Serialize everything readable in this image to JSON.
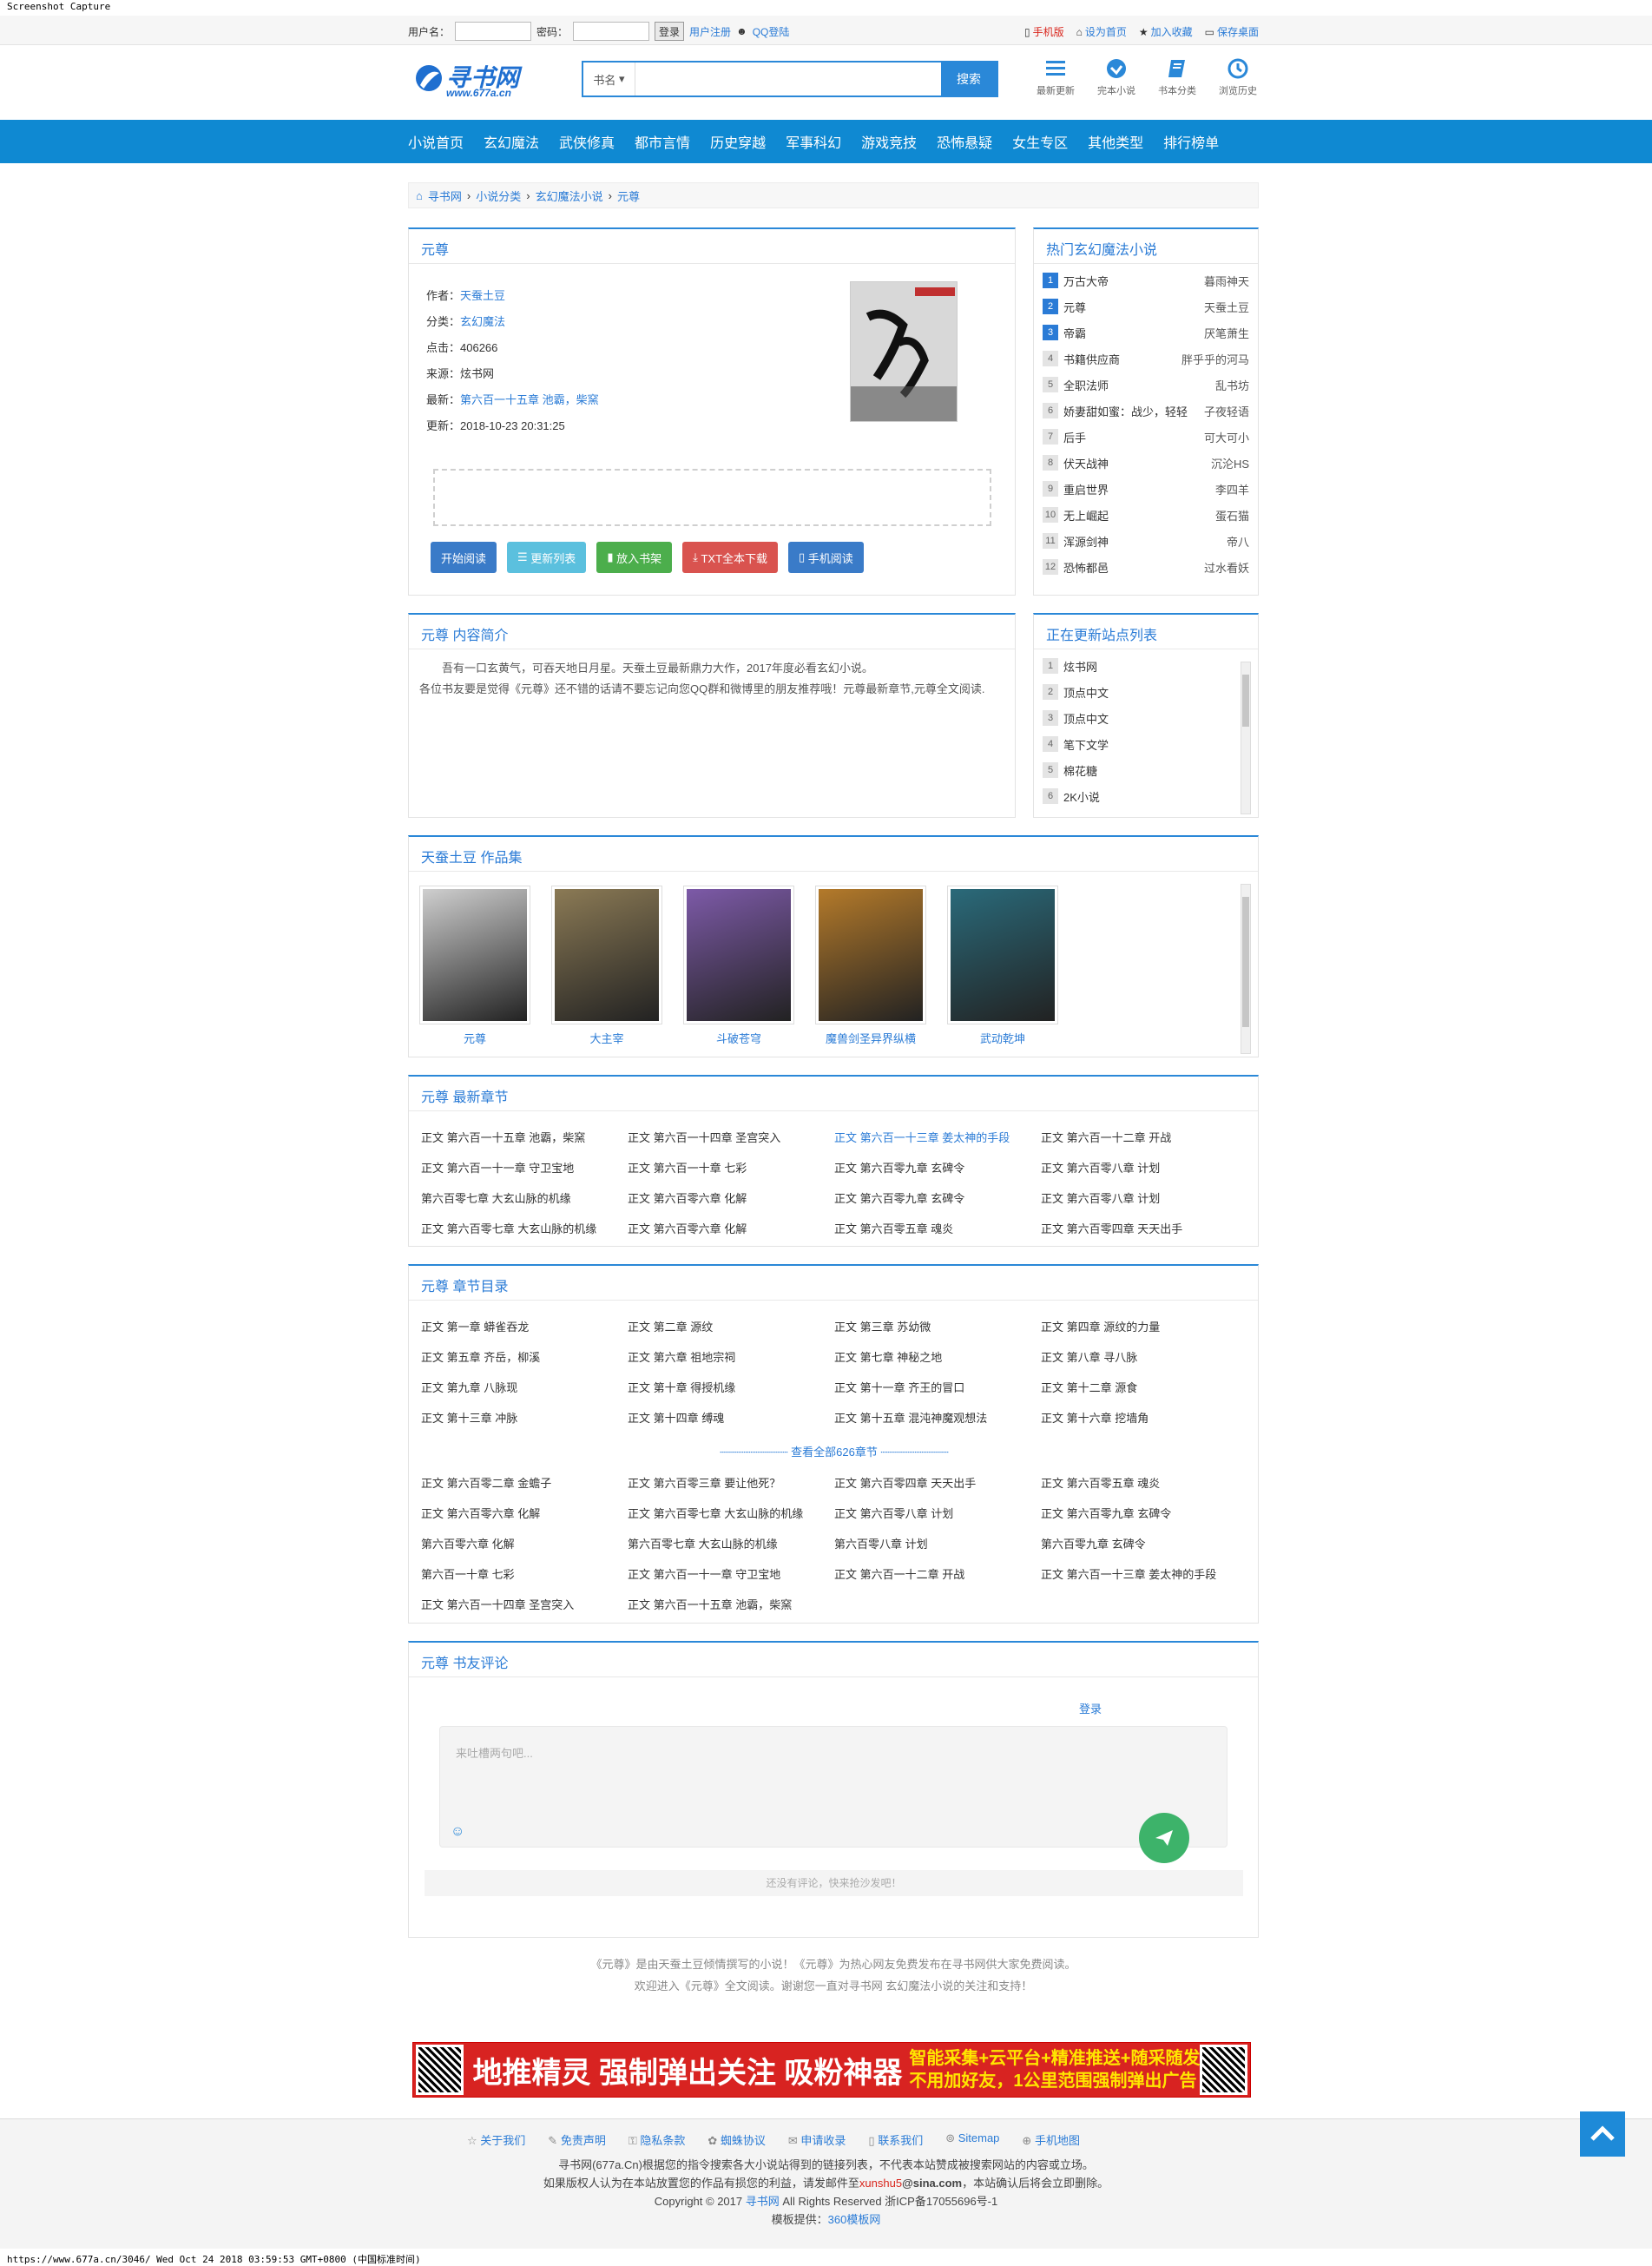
{
  "capture_title": "Screenshot Capture",
  "topbar": {
    "username_label": "用户名：",
    "password_label": "密码：",
    "login_btn": "登录",
    "register": "用户注册",
    "qq_login": "QQ登陆",
    "mobile": "手机版",
    "set_home": "设为首页",
    "favorite": "加入收藏",
    "save_desktop": "保存桌面"
  },
  "header": {
    "logo_text": "寻书网",
    "logo_url": "www.677a.cn",
    "search_select": "书名",
    "search_btn": "搜索",
    "quick": [
      "最新更新",
      "完本小说",
      "书本分类",
      "浏览历史"
    ]
  },
  "nav": [
    "小说首页",
    "玄幻魔法",
    "武侠修真",
    "都市言情",
    "历史穿越",
    "军事科幻",
    "游戏竞技",
    "恐怖悬疑",
    "女生专区",
    "其他类型",
    "排行榜单"
  ],
  "breadcrumb": [
    "寻书网",
    "小说分类",
    "玄幻魔法小说",
    "元尊"
  ],
  "book": {
    "title": "元尊",
    "author_label": "作者：",
    "author": "天蚕土豆",
    "category_label": "分类：",
    "category": "玄幻魔法",
    "clicks_label": "点击：",
    "clicks": "406266",
    "source_label": "来源：",
    "source": "炫书网",
    "latest_label": "最新：",
    "latest": "第六百一十五章 池霸，柴窯",
    "updated_label": "更新：",
    "updated": "2018-10-23 20:31:25",
    "buttons": [
      "开始阅读",
      "更新列表",
      "放入书架",
      "TXT全本下载",
      "手机阅读"
    ]
  },
  "hot": {
    "title": "热门玄幻魔法小说",
    "items": [
      {
        "n": "1",
        "name": "万古大帝",
        "author": "暮雨神天"
      },
      {
        "n": "2",
        "name": "元尊",
        "author": "天蚕土豆"
      },
      {
        "n": "3",
        "name": "帝霸",
        "author": "厌笔萧生"
      },
      {
        "n": "4",
        "name": "书籍供应商",
        "author": "胖乎乎的河马"
      },
      {
        "n": "5",
        "name": "全职法师",
        "author": "乱书坊"
      },
      {
        "n": "6",
        "name": "娇妻甜如蜜：战少，轻轻",
        "author": "子夜轻语"
      },
      {
        "n": "7",
        "name": "后手",
        "author": "可大可小"
      },
      {
        "n": "8",
        "name": "伏天战神",
        "author": "沉沦HS"
      },
      {
        "n": "9",
        "name": "重启世界",
        "author": "李四羊"
      },
      {
        "n": "10",
        "name": "无上崛起",
        "author": "蛋石猫"
      },
      {
        "n": "11",
        "name": "浑源剑神",
        "author": "帝八"
      },
      {
        "n": "12",
        "name": "恐怖都邑",
        "author": "过水看妖"
      }
    ]
  },
  "intro": {
    "title": "元尊 内容简介",
    "text1": "吾有一口玄黄气，可吞天地日月星。天蚕土豆最新鼎力大作，2017年度必看玄幻小说。",
    "text2": "各位书友要是觉得《元尊》还不错的话请不要忘记向您QQ群和微博里的朋友推荐哦！元尊最新章节,元尊全文阅读."
  },
  "sites": {
    "title": "正在更新站点列表",
    "items": [
      {
        "n": "1",
        "name": "炫书网"
      },
      {
        "n": "2",
        "name": "顶点中文"
      },
      {
        "n": "3",
        "name": "顶点中文"
      },
      {
        "n": "4",
        "name": "笔下文学"
      },
      {
        "n": "5",
        "name": "棉花糖"
      },
      {
        "n": "6",
        "name": "2K小说"
      }
    ]
  },
  "works": {
    "title": "天蚕土豆 作品集",
    "books": [
      {
        "name": "元尊",
        "color": "#cfcfcf"
      },
      {
        "name": "大主宰",
        "color": "#8b7a55"
      },
      {
        "name": "斗破苍穹",
        "color": "#7d5aa8"
      },
      {
        "name": "魔兽剑圣异界纵横",
        "color": "#b47a2a"
      },
      {
        "name": "武动乾坤",
        "color": "#2a6a7a"
      }
    ]
  },
  "latest": {
    "title": "元尊 最新章节",
    "chapters": [
      "正文 第六百一十五章 池霸，柴窯",
      "正文 第六百一十四章 圣宫突入",
      "正文 第六百一十三章 姜太神的手段",
      "正文 第六百一十二章 开战",
      "正文 第六百一十一章 守卫宝地",
      "正文 第六百一十章 七彩",
      "正文 第六百零九章 玄碑令",
      "正文 第六百零八章 计划",
      "第六百零七章 大玄山脉的机缘",
      "正文 第六百零六章 化解",
      "正文 第六百零九章 玄碑令",
      "正文 第六百零八章 计划",
      "正文 第六百零七章 大玄山脉的机缘",
      "正文 第六百零六章 化解",
      "正文 第六百零五章 魂炎",
      "正文 第六百零四章 天天出手"
    ]
  },
  "toc": {
    "title": "元尊 章节目录",
    "first": [
      "正文 第一章 蟒雀吞龙",
      "正文 第二章 源纹",
      "正文 第三章 苏幼微",
      "正文 第四章 源纹的力量",
      "正文 第五章 齐岳，柳溪",
      "正文 第六章 祖地宗祠",
      "正文 第七章 神秘之地",
      "正文 第八章 寻八脉",
      "正文 第九章 八脉现",
      "正文 第十章 得授机缘",
      "正文 第十一章 齐王的冒口",
      "正文 第十二章 源食",
      "正文 第十三章 冲脉",
      "正文 第十四章 缚魂",
      "正文 第十五章 混沌神魔观想法",
      "正文 第十六章 挖墙角"
    ],
    "more": "查看全部626章节",
    "last": [
      "正文 第六百零二章 金蟾子",
      "正文 第六百零三章 要让他死？",
      "正文 第六百零四章 天天出手",
      "正文 第六百零五章 魂炎",
      "正文 第六百零六章 化解",
      "正文 第六百零七章 大玄山脉的机缘",
      "正文 第六百零八章 计划",
      "正文 第六百零九章 玄碑令",
      "第六百零六章 化解",
      "第六百零七章 大玄山脉的机缘",
      "第六百零八章 计划",
      "第六百零九章 玄碑令",
      "第六百一十章 七彩",
      "正文 第六百一十一章 守卫宝地",
      "正文 第六百一十二章 开战",
      "正文 第六百一十三章 姜太神的手段",
      "正文 第六百一十四章 圣宫突入",
      "正文 第六百一十五章 池霸，柴窯"
    ]
  },
  "comments": {
    "title": "元尊 书友评论",
    "login": "登录",
    "placeholder": "来吐槽两句吧...",
    "empty": "还没有评论，快来抢沙发吧！"
  },
  "desc": {
    "line1": "《元尊》是由天蚕土豆倾情撰写的小说！《元尊》为热心网友免费发布在寻书网供大家免费阅读。",
    "line2": "欢迎进入《元尊》全文阅读。谢谢您一直对寻书网 玄幻魔法小说的关注和支持！"
  },
  "ad": {
    "main": "地推精灵 强制弹出关注 吸粉神器",
    "line1": "智能采集+云平台+精准推送+随采随发",
    "line2": "不用加好友，1公里范围强制弹出广告"
  },
  "footer": {
    "links": [
      "关于我们",
      "免责声明",
      "隐私条款",
      "蜘蛛协议",
      "申请收录",
      "联系我们",
      "Sitemap",
      "手机地图"
    ],
    "line1": "寻书网(677a.Cn)根据您的指令搜索各大小说站得到的链接列表，不代表本站赞成被搜索网站的内容或立场。",
    "line2a": "如果版权人认为在本站放置您的作品有损您的利益，请发邮件至",
    "line2b": "xunshu5",
    "line2c": "@sina.com",
    "line2d": "，本站确认后将会立即删除。",
    "line3a": "Copyright © 2017",
    "line3b": "寻书网",
    "line3c": "All Rights Reserved 浙ICP备17055696号-1",
    "line4a": "模板提供：",
    "line4b": "360模板网"
  },
  "status": "https://www.677a.cn/3046/ Wed Oct 24 2018 03:59:53 GMT+0800 (中国标准时间)",
  "colors": {
    "accent": "#0f89d2",
    "link": "#2a7bd6",
    "btn_read": "#3a7bc8",
    "btn_list": "#5bc0de",
    "btn_shelf": "#4cae4c",
    "btn_txt": "#d9534f",
    "btn_mobile": "#3a7bc8"
  }
}
